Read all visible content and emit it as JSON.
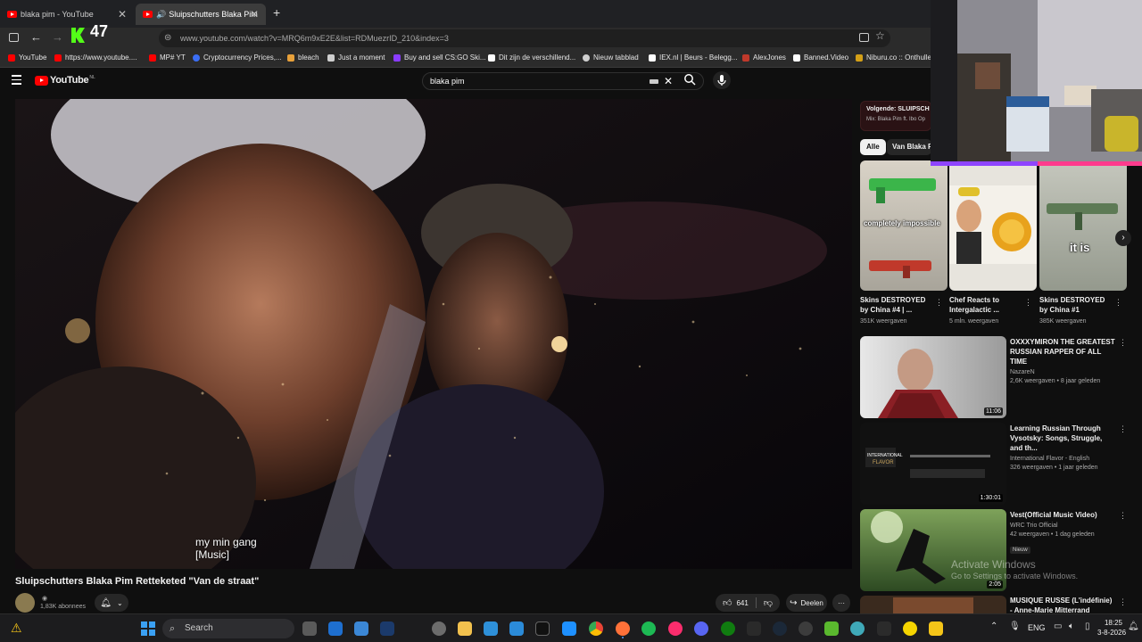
{
  "browser": {
    "tabs": [
      {
        "title": "blaka pim - YouTube",
        "active": false
      },
      {
        "title": "Sluipschutters Blaka Pim Re",
        "active": true
      }
    ],
    "new_tab": "+",
    "counter_badge": "47",
    "url": "www.youtube.com/watch?v=MRQ6m9xE2E&list=RDMuezrID_210&index=3",
    "bookmarks": [
      {
        "label": "YouTube",
        "color": "#ff0000"
      },
      {
        "label": "https://www.youtube....",
        "color": "#ff0000"
      },
      {
        "label": "MP# YT",
        "color": "#ff0000"
      },
      {
        "label": "Cryptocurrency Prices,...",
        "color": "#3b6ef5"
      },
      {
        "label": "bleach",
        "color": "#e8a13a"
      },
      {
        "label": "Just a moment",
        "color": "#cfcfcf"
      },
      {
        "label": "Buy and sell CS:GO Ski...",
        "color": "#8a3cff"
      },
      {
        "label": "Dit zijn de verschillend...",
        "color": "#ffffff"
      },
      {
        "label": "Nieuw tabblad",
        "color": "#cfcfcf"
      },
      {
        "label": "IEX.nl | Beurs - Belegg...",
        "color": "#ffffff"
      },
      {
        "label": "AlexJones",
        "color": "#c0392b"
      },
      {
        "label": "Banned.Video",
        "color": "#ffffff"
      },
      {
        "label": "Niburu.co :: Onthulle",
        "color": "#d4a017"
      }
    ]
  },
  "youtube": {
    "logo": "YouTube",
    "logo_region": "NL",
    "search_value": "blaka pim",
    "caption_line1": "my  min gang",
    "caption_line2": "[Music]",
    "video_title": "Sluipschutters Blaka Pim Retteketed \"Van de straat\"",
    "subscribers": "1,83K abonnees",
    "likes": "641",
    "share": "Deelen",
    "more": "···"
  },
  "sidebar": {
    "up_next_label": "Volgende: SLUIPSCH",
    "up_next_sub": "Mix: Blaka Pim ft. Ibo Op",
    "chips": [
      "Alle",
      "Van Blaka Pi"
    ],
    "shorts": [
      {
        "title": "Skins DESTROYED by China #4 | ...",
        "views": "351K weergaven",
        "overlay": "completely impossible"
      },
      {
        "title": "Chef Reacts to Intergalactic ...",
        "views": "5 mln. weergaven",
        "overlay": ""
      },
      {
        "title": "Skins DESTROYED by China #1",
        "views": "385K weergaven",
        "overlay": "it is"
      }
    ],
    "videos": [
      {
        "title": "OXXXYMIRON THE GREATEST RUSSIAN RAPPER OF ALL TIME",
        "channel": "NazareN",
        "meta": "2,6K weergaven • 8 jaar geleden",
        "duration": "11:06",
        "badge": ""
      },
      {
        "title": "Learning Russian Through Vysotsky: Songs, Struggle, and th...",
        "channel": "International Flavor - English",
        "meta": "326 weergaven • 1 jaar geleden",
        "duration": "1:30:01",
        "badge": ""
      },
      {
        "title": "Vest(Official Music Video)",
        "channel": "WRC Trio Official",
        "meta": "42 weergaven • 1 dag geleden",
        "duration": "2:05",
        "badge": "Nieuw"
      },
      {
        "title": "MUSIQUE RUSSE (L'indéfinie) - Anne-Marie Mitterrand",
        "channel": "",
        "meta": "",
        "duration": "",
        "badge": ""
      }
    ]
  },
  "watermark": {
    "line1": "Activate Windows",
    "line2": "Go to Settings to activate Windows."
  },
  "taskbar": {
    "search_placeholder": "Search",
    "language": "ENG",
    "time": "18:25",
    "date": "3-8-2026"
  },
  "colors": {
    "accent_red": "#ff0000",
    "bg": "#0f0f0f",
    "up_next_red": "#c4202a"
  }
}
